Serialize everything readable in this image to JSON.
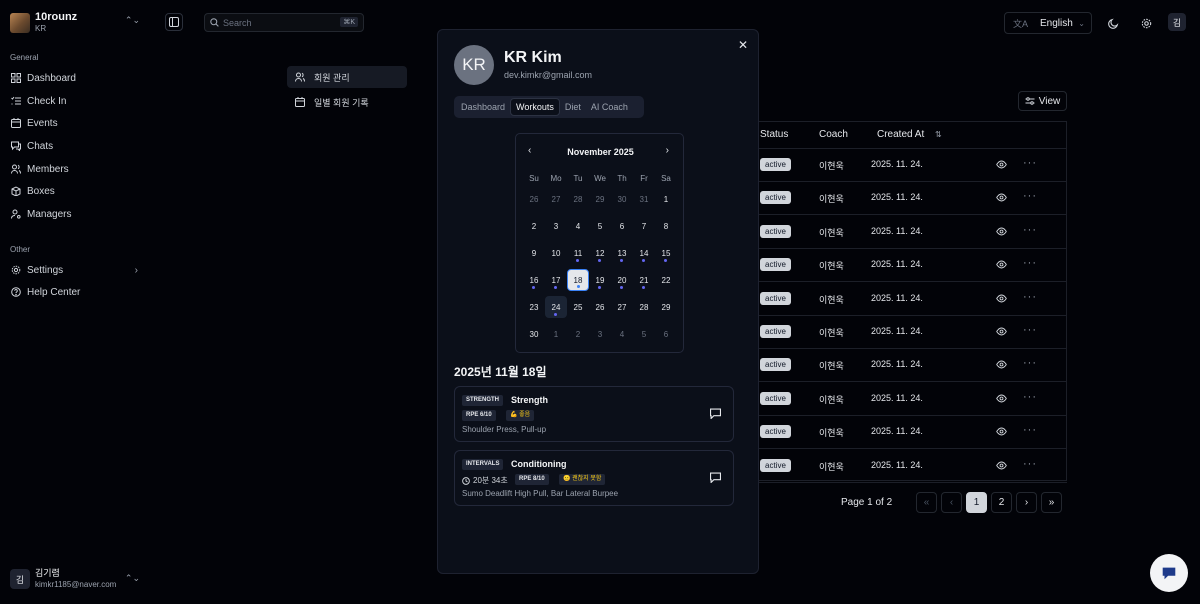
{
  "brand": {
    "name": "10rounz",
    "sub": "KR"
  },
  "sidebar": {
    "general_label": "General",
    "items": [
      {
        "label": "Dashboard",
        "icon": "grid-icon"
      },
      {
        "label": "Check In",
        "icon": "list-check-icon"
      },
      {
        "label": "Events",
        "icon": "calendar-icon"
      },
      {
        "label": "Chats",
        "icon": "chat-icon"
      },
      {
        "label": "Members",
        "icon": "users-icon"
      },
      {
        "label": "Boxes",
        "icon": "box-icon"
      },
      {
        "label": "Managers",
        "icon": "user-cog-icon"
      }
    ],
    "other_label": "Other",
    "other_items": [
      {
        "label": "Settings",
        "icon": "gear-icon"
      },
      {
        "label": "Help Center",
        "icon": "help-icon"
      }
    ]
  },
  "user": {
    "initial": "김",
    "name": "김기렴",
    "email": "kimkr1185@naver.com"
  },
  "topbar": {
    "search_placeholder": "Search",
    "search_kbd": "⌘K",
    "language": "English",
    "avatar_initial": "김"
  },
  "subnav": [
    {
      "label": "회원 관리",
      "icon": "users-icon"
    },
    {
      "label": "일별 회원 기록",
      "icon": "calendar-icon"
    }
  ],
  "table": {
    "view_label": "View",
    "headers": {
      "status": "Status",
      "coach": "Coach",
      "created": "Created At"
    },
    "rows": [
      {
        "status": "active",
        "coach": "이현욱",
        "created": "2025. 11. 24."
      },
      {
        "status": "active",
        "coach": "이현욱",
        "created": "2025. 11. 24."
      },
      {
        "status": "active",
        "coach": "이현욱",
        "created": "2025. 11. 24."
      },
      {
        "status": "active",
        "coach": "이현욱",
        "created": "2025. 11. 24."
      },
      {
        "status": "active",
        "coach": "이현욱",
        "created": "2025. 11. 24."
      },
      {
        "status": "active",
        "coach": "이현욱",
        "created": "2025. 11. 24."
      },
      {
        "status": "active",
        "coach": "이현욱",
        "created": "2025. 11. 24."
      },
      {
        "status": "active",
        "coach": "이현욱",
        "created": "2025. 11. 24."
      },
      {
        "status": "active",
        "coach": "이현욱",
        "created": "2025. 11. 24."
      },
      {
        "status": "active",
        "coach": "이현욱",
        "created": "2025. 11. 24."
      }
    ],
    "pager_text": "Page 1 of 2",
    "pages": [
      "1",
      "2"
    ]
  },
  "modal": {
    "avatar": "KR",
    "name": "KR Kim",
    "email": "dev.kimkr@gmail.com",
    "tabs": [
      "Dashboard",
      "Workouts",
      "Diet",
      "AI Coach"
    ],
    "active_tab": "Workouts",
    "calendar": {
      "month": "November 2025",
      "weekdays": [
        "Su",
        "Mo",
        "Tu",
        "We",
        "Th",
        "Fr",
        "Sa"
      ],
      "weeks": [
        [
          "26",
          "27",
          "28",
          "29",
          "30",
          "31",
          "1"
        ],
        [
          "2",
          "3",
          "4",
          "5",
          "6",
          "7",
          "8"
        ],
        [
          "9",
          "10",
          "11",
          "12",
          "13",
          "14",
          "15"
        ],
        [
          "16",
          "17",
          "18",
          "19",
          "20",
          "21",
          "22"
        ],
        [
          "23",
          "24",
          "25",
          "26",
          "27",
          "28",
          "29"
        ],
        [
          "30",
          "1",
          "2",
          "3",
          "4",
          "5",
          "6"
        ]
      ],
      "outside": [
        [
          0,
          0
        ],
        [
          0,
          1
        ],
        [
          0,
          2
        ],
        [
          0,
          3
        ],
        [
          0,
          4
        ],
        [
          0,
          5
        ],
        [
          5,
          1
        ],
        [
          5,
          2
        ],
        [
          5,
          3
        ],
        [
          5,
          4
        ],
        [
          5,
          5
        ],
        [
          5,
          6
        ]
      ],
      "workout_days": [
        "11",
        "12",
        "13",
        "14",
        "15",
        "16",
        "17",
        "18",
        "19",
        "20",
        "21",
        "24"
      ],
      "selected": "18",
      "today": "24"
    },
    "date_title": "2025년 11월 18일",
    "workouts": [
      {
        "type": "STRENGTH",
        "title": "Strength",
        "rpe": "RPE 6/10",
        "mood": "💪 좋음",
        "exercises": "Shoulder Press, Pull-up"
      },
      {
        "type": "INTERVALS",
        "title": "Conditioning",
        "duration": "20분 34초",
        "rpe": "RPE 8/10",
        "mood": "😐 괜찮지 못함",
        "exercises": "Sumo Deadlift High Pull, Bar Lateral Burpee"
      }
    ]
  },
  "colors": {
    "background": "#020308",
    "accent_dot": "#6366f1",
    "badge": "#d1d5db"
  }
}
